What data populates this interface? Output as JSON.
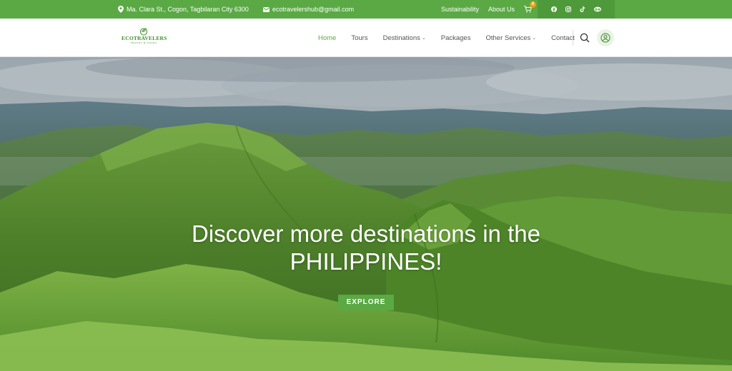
{
  "topbar": {
    "address": "Ma. Clara St., Cogon, Tagbilaran City 6300",
    "email": "ecotravelershub@gmail.com",
    "links": [
      "Sustainability",
      "About Us"
    ],
    "cart_count": "0",
    "social": [
      "facebook-icon",
      "instagram-icon",
      "tiktok-icon",
      "tripadvisor-icon"
    ]
  },
  "header": {
    "logo_brand": "ECOTRAVELERS",
    "logo_tagline": "TRAVEL & TOURS",
    "nav": [
      {
        "label": "Home",
        "active": true
      },
      {
        "label": "Tours"
      },
      {
        "label": "Destinations",
        "dropdown": true
      },
      {
        "label": "Packages"
      },
      {
        "label": "Other Services",
        "dropdown": true
      },
      {
        "label": "Contact"
      }
    ]
  },
  "hero": {
    "title_line1": "Discover more destinations in the",
    "title_line2": "PHILIPPINES!",
    "button_label": "EXPLORE"
  },
  "colors": {
    "brand_green": "#5aa944",
    "social_bg": "#4e9a3a",
    "cart_badge": "#f39c12"
  }
}
